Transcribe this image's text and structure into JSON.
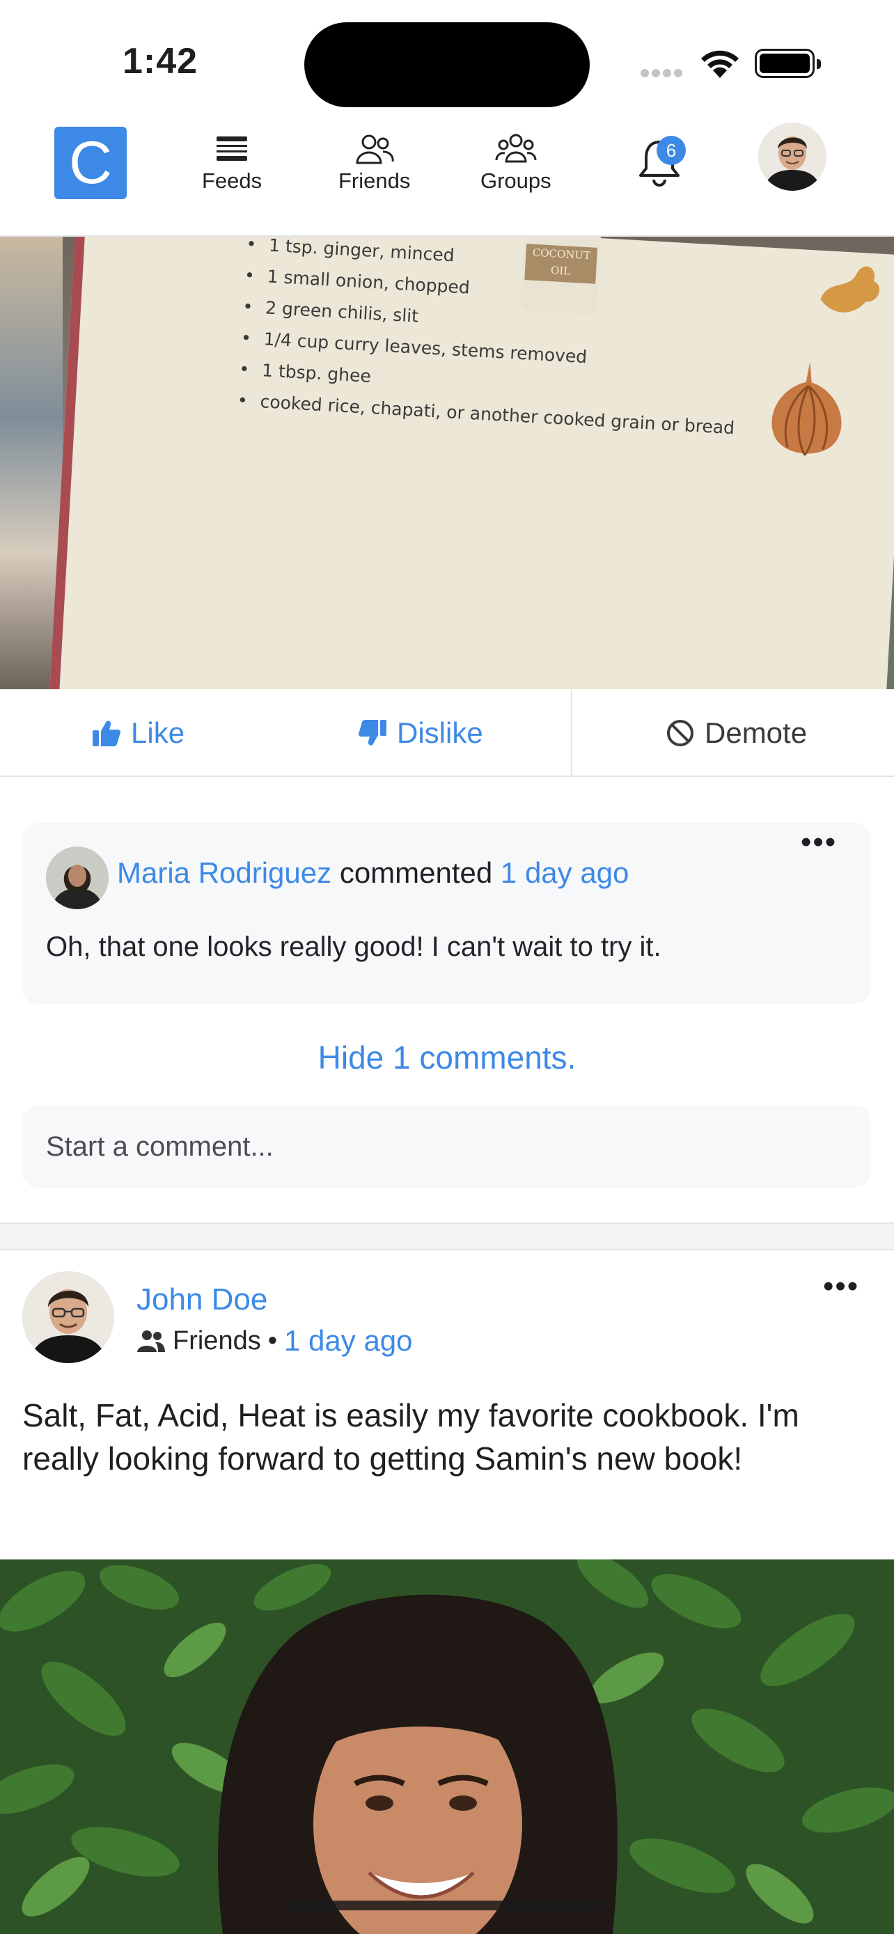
{
  "status_bar": {
    "time": "1:42"
  },
  "nav": {
    "logo_letter": "C",
    "items": [
      {
        "label": "Feeds",
        "icon": "feeds-icon"
      },
      {
        "label": "Friends",
        "icon": "friends-icon"
      },
      {
        "label": "Groups",
        "icon": "groups-icon"
      }
    ],
    "notifications_count": "6",
    "accent_color": "#3d89e6"
  },
  "recipe_image": {
    "ingredients": [
      "1 tsp. ginger, minced",
      "1 small onion, chopped",
      "2 green chilis, slit",
      "1/4 cup curry leaves, stems removed",
      "1 tbsp. ghee",
      "cooked rice, chapati, or another cooked grain or bread"
    ],
    "jar_label": "COCONUT OIL"
  },
  "actions": {
    "like": "Like",
    "dislike": "Dislike",
    "demote": "Demote"
  },
  "comment": {
    "author": "Maria Rodriguez",
    "verb": "commented",
    "time": "1 day ago",
    "text": "Oh, that one looks really good! I can't wait to try it."
  },
  "hide_comments": "Hide 1 comments.",
  "comment_input": {
    "placeholder": "Start a comment..."
  },
  "post2": {
    "author": "John Doe",
    "audience": "Friends",
    "separator": "•",
    "time": "1 day ago",
    "text": "Salt, Fat, Acid, Heat is easily my favorite cookbook. I'm really looking forward to getting Samin's new book!"
  }
}
